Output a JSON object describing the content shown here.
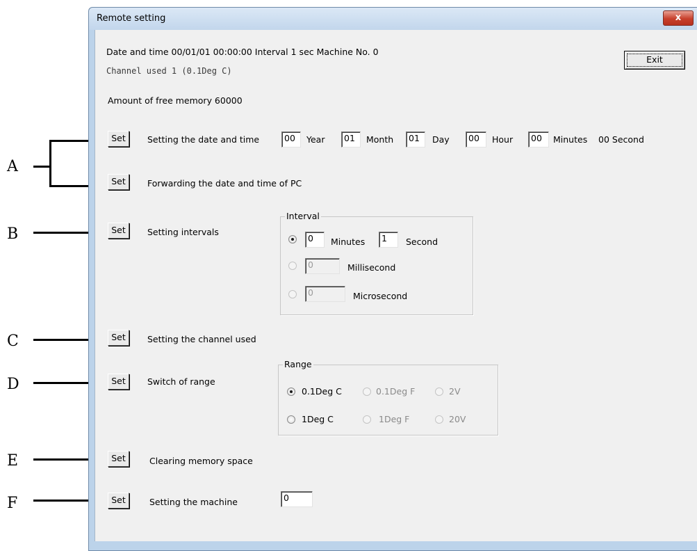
{
  "window": {
    "title": "Remote setting",
    "close_glyph": "x"
  },
  "status": {
    "line1": "Date and time 00/01/01  00:00:00   Interval 1 sec   Machine No. 0",
    "line2": "Channel used   1  (0.1Deg C)",
    "memory": "Amount of free memory 60000"
  },
  "exit_label": "Exit",
  "set_label": "Set",
  "datetime": {
    "label": "Setting the date and time",
    "year": "00",
    "year_label": "Year",
    "month": "01",
    "month_label": "Month",
    "day": "01",
    "day_label": "Day",
    "hour": "00",
    "hour_label": "Hour",
    "minute": "00",
    "minute_label": "Minutes",
    "second_text": "00 Second"
  },
  "forward_label": "Forwarding the date and time of PC",
  "interval": {
    "label": "Setting intervals",
    "group_title": "Interval",
    "minutes": "0",
    "minutes_label": "Minutes",
    "seconds": "1",
    "seconds_label": "Second",
    "millis": "0",
    "millis_label": "Millisecond",
    "micros": "0",
    "micros_label": "Microsecond"
  },
  "channel_label": "Setting the channel used",
  "range": {
    "label": "Switch of range",
    "group_title": "Range",
    "options": [
      "0.1Deg C",
      "0.1Deg F",
      "2V",
      "1Deg C",
      "1Deg F",
      "20V"
    ]
  },
  "clear_label": "Clearing memory space",
  "machine": {
    "label": "Setting the machine",
    "value": "0"
  },
  "annotations": [
    "A",
    "B",
    "C",
    "D",
    "E",
    "F"
  ]
}
